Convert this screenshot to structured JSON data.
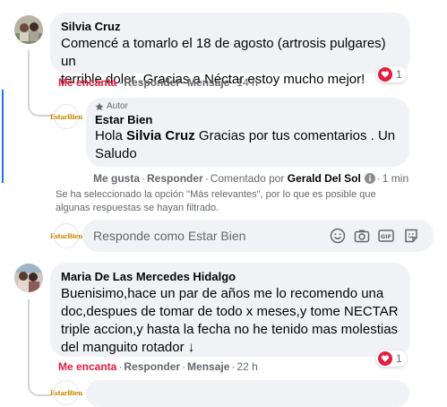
{
  "comments": [
    {
      "author": "Silvia Cruz",
      "text_line1": "Comencé a tomarlo el 18 de agosto (artrosis pulgares) un",
      "text_line2": "terrible dolor .Gracias a Néctar estoy mucho mejor!",
      "reaction_count": "1",
      "actions": {
        "like": "Me encanta",
        "reply": "Responder",
        "message": "Mensaje",
        "time": "14 h"
      }
    },
    {
      "author": "Maria De Las Mercedes Hidalgo",
      "text_line1": "Buenisimo,hace un par de años me lo recomendo una",
      "text_line2": "doc,despues de tomar de todo x meses,y tome NECTAR",
      "text_line3": "triple accion,y hasta la fecha no he tenido mas molestias",
      "text_line4": "del manguito rotador",
      "text_arrow": "↓",
      "reaction_count": "1",
      "actions": {
        "like": "Me encanta",
        "reply": "Responder",
        "message": "Mensaje",
        "time": "22 h"
      }
    }
  ],
  "reply": {
    "author_badge": "Autor",
    "author": "Estar Bien",
    "text_prefix": "Hola ",
    "mention": "Silvia Cruz",
    "text_line1_rest": " Gracias por tus comentarios . Un",
    "text_line2": "Saludo",
    "actions": {
      "like": "Me gusta",
      "reply": "Responder",
      "commented_by": "Comentado por",
      "commenter": "Gerald Del Sol",
      "time": "1 min"
    }
  },
  "filter_notice_line1": "Se ha seleccionado la opción \"Más relevantes\", por lo que es posible que",
  "filter_notice_line2": "algunas respuestas se hayan filtrado.",
  "composer": {
    "placeholder": "Responde como Estar Bien"
  },
  "brand_logo_text": "EstarBien",
  "colors": {
    "bubble": "#f0f2f5",
    "love_red": "#e41e3f",
    "secondary_text": "#65676b"
  },
  "icons": [
    "heart-icon",
    "star-icon",
    "info-icon",
    "emoji-icon",
    "camera-icon",
    "gif-icon",
    "sticker-icon"
  ]
}
